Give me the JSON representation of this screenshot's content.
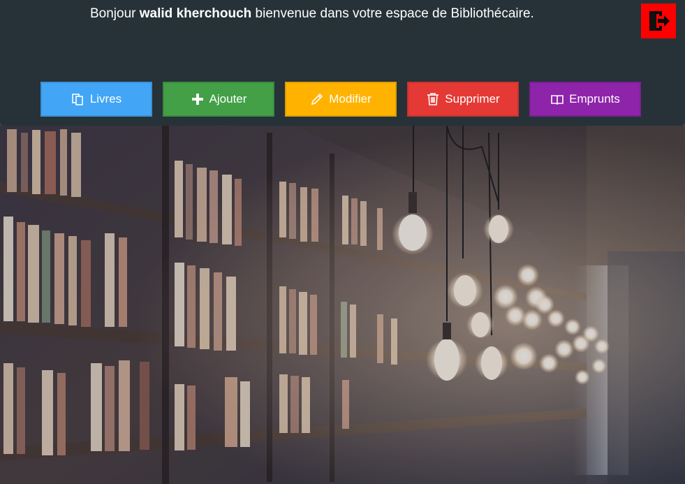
{
  "header": {
    "greeting": "Bonjour",
    "user_name": "walid kherchouch",
    "message": "bienvenue dans votre espace de Bibliothécaire."
  },
  "logout": {
    "icon": "logout-door-icon",
    "color": "#ff0000"
  },
  "nav": [
    {
      "label": "Livres",
      "icon": "books-icon",
      "color": "#42a5f5"
    },
    {
      "label": "Ajouter",
      "icon": "plus-icon",
      "color": "#43a047"
    },
    {
      "label": "Modifier",
      "icon": "pencil-icon",
      "color": "#ffb300"
    },
    {
      "label": "Supprimer",
      "icon": "trash-icon",
      "color": "#e53935"
    },
    {
      "label": "Emprunts",
      "icon": "book-open-icon",
      "color": "#8e24aa"
    }
  ]
}
